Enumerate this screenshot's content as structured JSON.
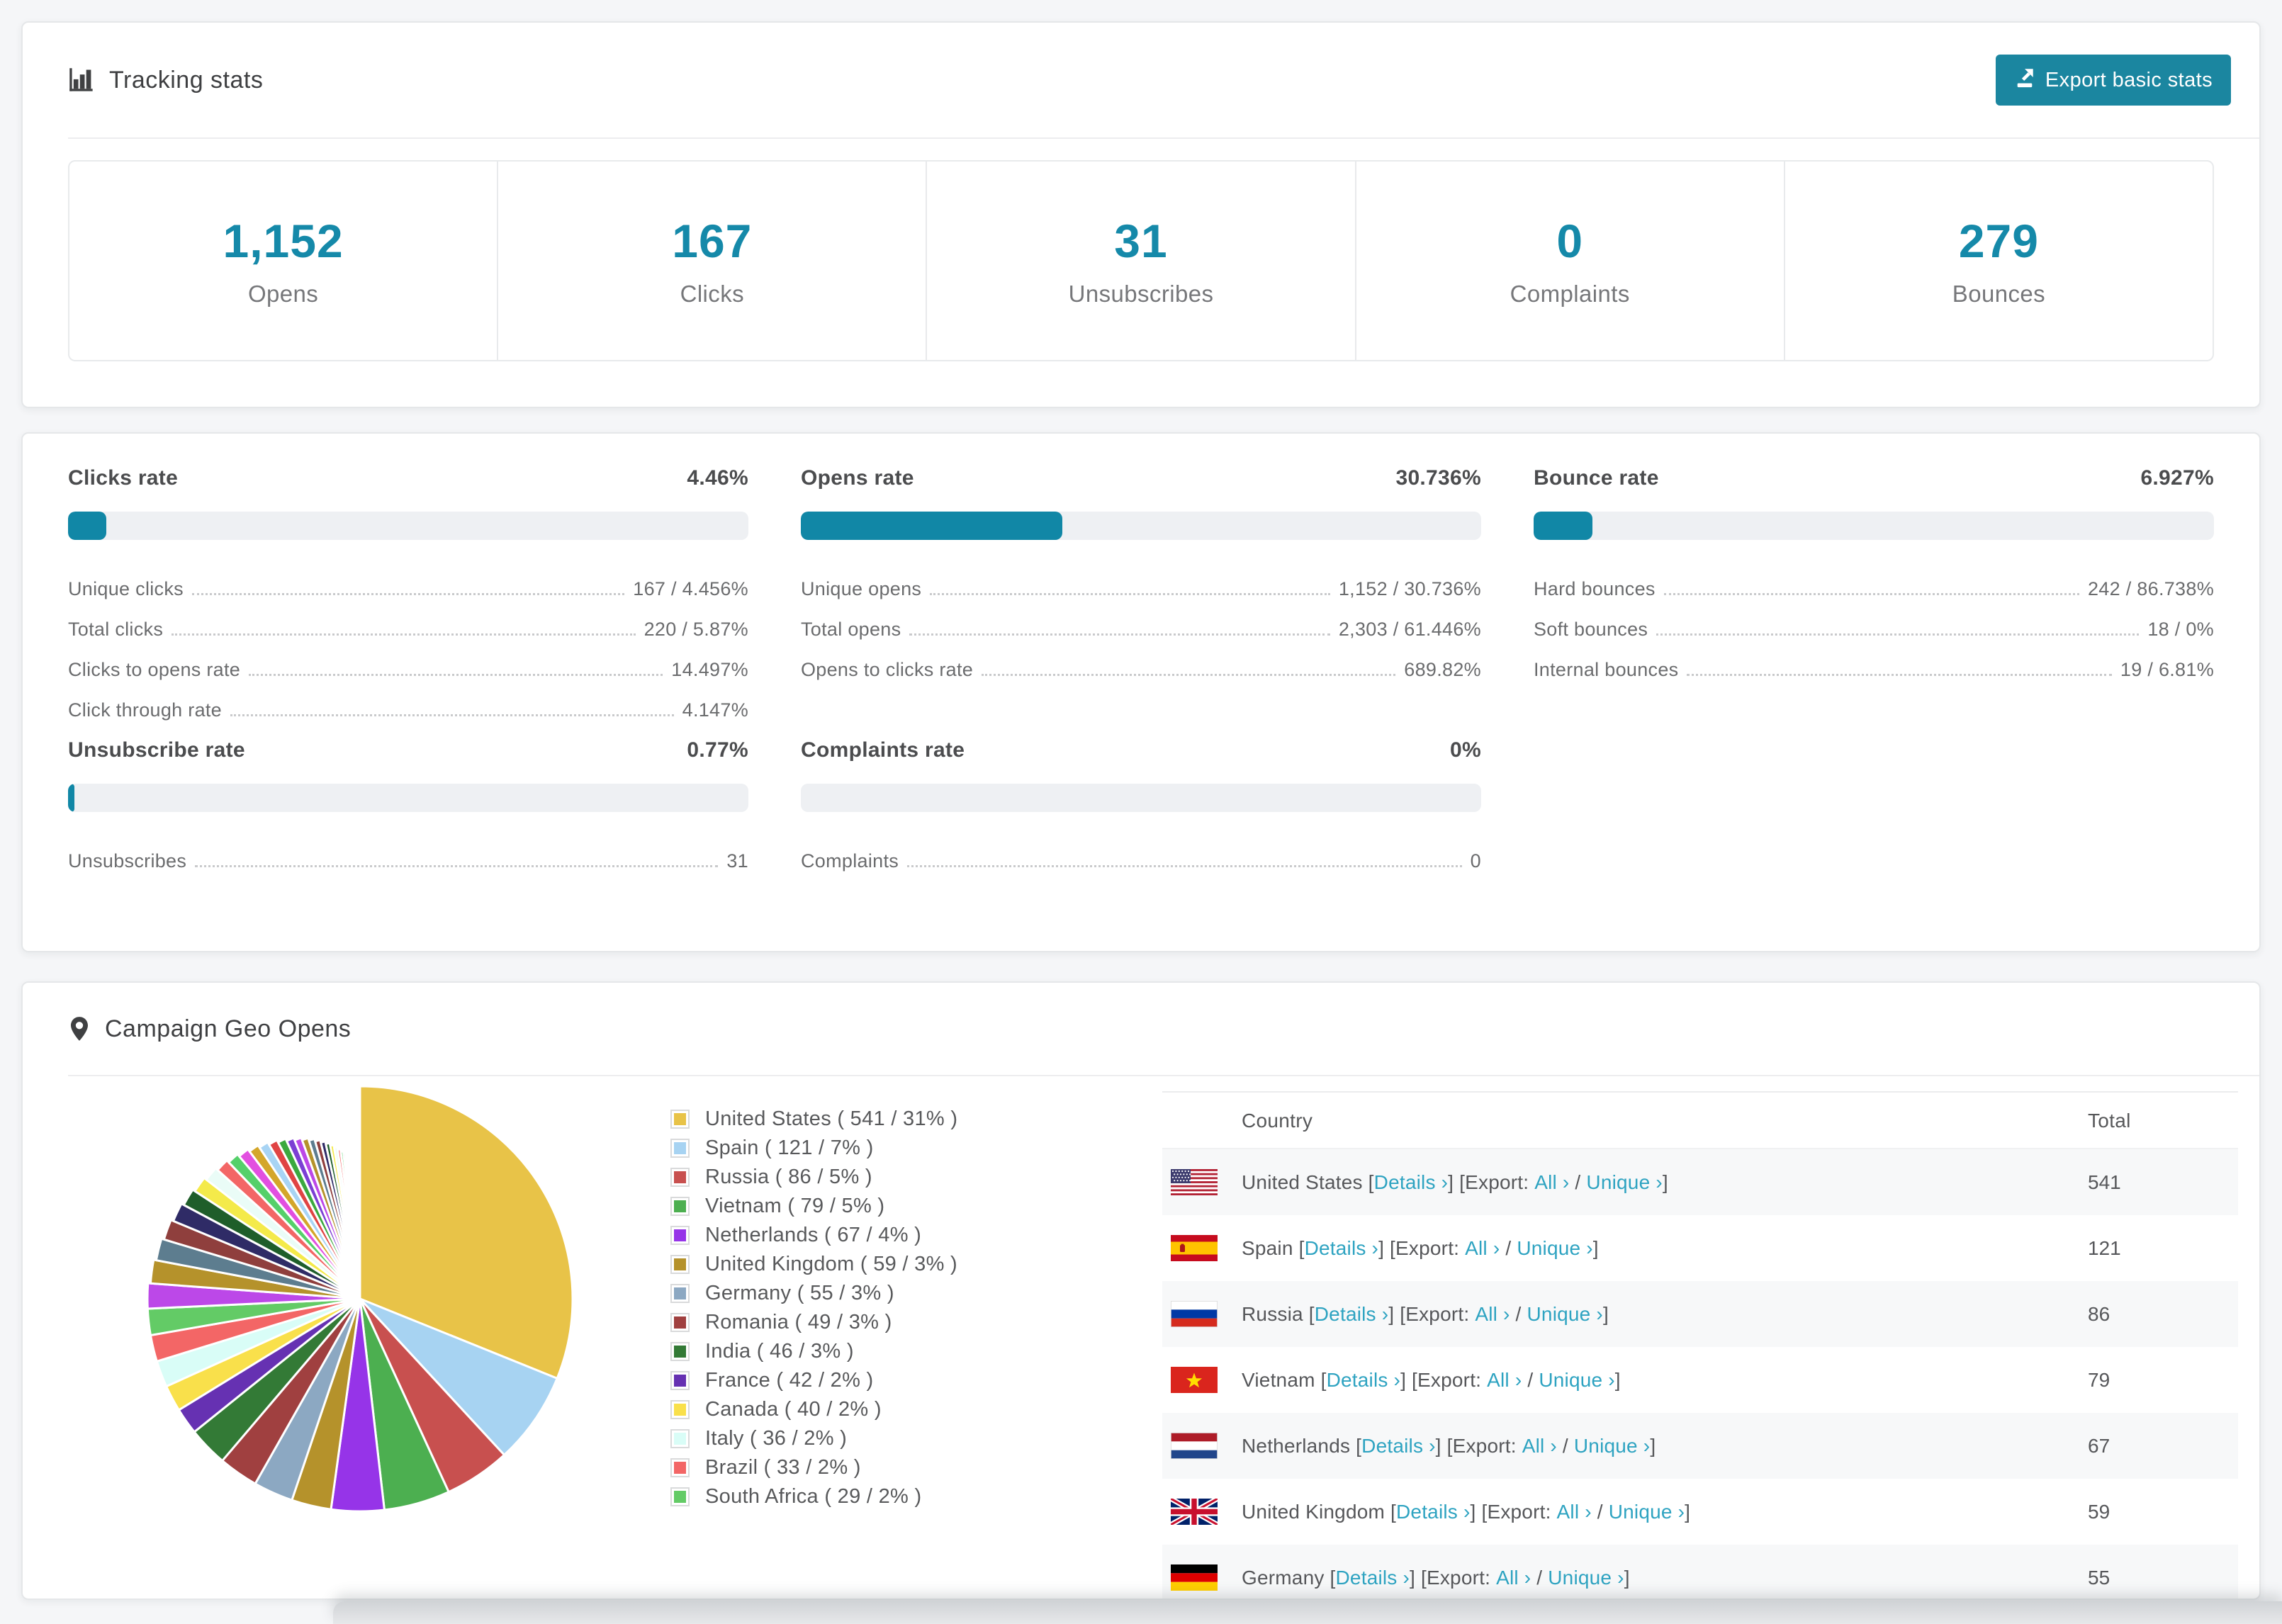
{
  "colors": {
    "accent_teal": "#1b86a0",
    "stat_teal": "#1589a9",
    "bar_teal": "#1187a6",
    "link_teal": "#2ea3c1",
    "bar_track": "#eef0f3",
    "stripe": "#f7f8f9"
  },
  "tracking": {
    "title": "Tracking stats",
    "export_button": "Export basic stats",
    "stats": [
      {
        "value": "1,152",
        "label": "Opens"
      },
      {
        "value": "167",
        "label": "Clicks"
      },
      {
        "value": "31",
        "label": "Unsubscribes"
      },
      {
        "value": "0",
        "label": "Complaints"
      },
      {
        "value": "279",
        "label": "Bounces"
      }
    ]
  },
  "rates": {
    "blocks": [
      {
        "title": "Clicks rate",
        "value": "4.46%",
        "bar_pct": 4.46,
        "rows": [
          {
            "label": "Unique clicks",
            "value": "167 / 4.456%"
          },
          {
            "label": "Total clicks",
            "value": "220 / 5.87%"
          },
          {
            "label": "Clicks to opens rate",
            "value": "14.497%"
          },
          {
            "label": "Click through rate",
            "value": "4.147%"
          }
        ]
      },
      {
        "title": "Opens rate",
        "value": "30.736%",
        "bar_pct": 30.736,
        "rows": [
          {
            "label": "Unique opens",
            "value": "1,152 / 30.736%"
          },
          {
            "label": "Total opens",
            "value": "2,303 / 61.446%"
          },
          {
            "label": "Opens to clicks rate",
            "value": "689.82%"
          }
        ]
      },
      {
        "title": "Bounce rate",
        "value": "6.927%",
        "bar_pct": 6.927,
        "rows": [
          {
            "label": "Hard bounces",
            "value": "242 / 86.738%"
          },
          {
            "label": "Soft bounces",
            "value": "18 / 0%"
          },
          {
            "label": "Internal bounces",
            "value": "19 / 6.81%"
          }
        ]
      },
      {
        "title": "Unsubscribe rate",
        "value": "0.77%",
        "bar_pct": 0.77,
        "rows": [
          {
            "label": "Unsubscribes",
            "value": "31"
          }
        ]
      },
      {
        "title": "Complaints rate",
        "value": "0%",
        "bar_pct": 0,
        "rows": [
          {
            "label": "Complaints",
            "value": "0"
          }
        ]
      }
    ]
  },
  "geo": {
    "title": "Campaign Geo Opens",
    "chart_data": {
      "type": "pie",
      "title": "Campaign Geo Opens",
      "legend_position": "right",
      "slices": [
        {
          "name": "United States",
          "value": 541,
          "pct": 31,
          "color": "#e8c348",
          "flag": "us"
        },
        {
          "name": "Spain",
          "value": 121,
          "pct": 7,
          "color": "#a7d3f2",
          "flag": "es"
        },
        {
          "name": "Russia",
          "value": 86,
          "pct": 5,
          "color": "#c8504f",
          "flag": "ru"
        },
        {
          "name": "Vietnam",
          "value": 79,
          "pct": 5,
          "color": "#4caf50",
          "flag": "vn"
        },
        {
          "name": "Netherlands",
          "value": 67,
          "pct": 4,
          "color": "#9634e8",
          "flag": "nl"
        },
        {
          "name": "United Kingdom",
          "value": 59,
          "pct": 3,
          "color": "#b5922b",
          "flag": "gb"
        },
        {
          "name": "Germany",
          "value": 55,
          "pct": 3,
          "color": "#8ca8c2",
          "flag": "de"
        },
        {
          "name": "Romania",
          "value": 49,
          "pct": 3,
          "color": "#a04040",
          "flag": "ro"
        },
        {
          "name": "India",
          "value": 46,
          "pct": 3,
          "color": "#337a36",
          "flag": "in"
        },
        {
          "name": "France",
          "value": 42,
          "pct": 2,
          "color": "#6631b2",
          "flag": "fr"
        },
        {
          "name": "Canada",
          "value": 40,
          "pct": 2,
          "color": "#f9e04b",
          "flag": "ca"
        },
        {
          "name": "Italy",
          "value": 36,
          "pct": 2,
          "color": "#d9fdf7",
          "flag": "it"
        },
        {
          "name": "Brazil",
          "value": 33,
          "pct": 2,
          "color": "#f36666",
          "flag": "br"
        },
        {
          "name": "South Africa",
          "value": 29,
          "pct": 2,
          "color": "#63cb66",
          "flag": "za"
        }
      ],
      "others_pcts": [
        1.9,
        1.8,
        1.7,
        1.6,
        1.5,
        1.4,
        1.3,
        1.2,
        1.1,
        1.0,
        0.95,
        0.9,
        0.85,
        0.8,
        0.75,
        0.7,
        0.65,
        0.6,
        0.55,
        0.5,
        0.45,
        0.4,
        0.36,
        0.33,
        0.3,
        0.27,
        0.24,
        0.21,
        0.19,
        0.17,
        0.15,
        0.13,
        0.11,
        0.1,
        0.09,
        0.08,
        0.07,
        0.06,
        0.05,
        0.04,
        0.03,
        0.03,
        0.02,
        0.02
      ],
      "others_palette": [
        "#bc48e8",
        "#b5922b",
        "#5d7d8f",
        "#8f3f3d",
        "#2f2b66",
        "#1f5e2a",
        "#f4ea4a",
        "#eafcf7",
        "#f36666",
        "#55d06a",
        "#e24fe0",
        "#d4a62a",
        "#a8d4f4",
        "#e04444",
        "#3ba93f",
        "#7c3fd4"
      ]
    },
    "legend_format": {
      "open": " ( ",
      "sep": " / ",
      "close": "% )"
    },
    "table": {
      "headers": {
        "country": "Country",
        "total": "Total"
      },
      "tokens": {
        "lb": " [",
        "rb": "]",
        "details": "Details ›",
        "export": "Export: ",
        "all": "All ›",
        "slash": " / ",
        "unique": "Unique ›"
      },
      "rows": [
        {
          "country": "United States",
          "total": "541",
          "flag": "us"
        },
        {
          "country": "Spain",
          "total": "121",
          "flag": "es"
        },
        {
          "country": "Russia",
          "total": "86",
          "flag": "ru"
        },
        {
          "country": "Vietnam",
          "total": "79",
          "flag": "vn"
        },
        {
          "country": "Netherlands",
          "total": "67",
          "flag": "nl"
        },
        {
          "country": "United Kingdom",
          "total": "59",
          "flag": "gb"
        },
        {
          "country": "Germany",
          "total": "55",
          "flag": "de"
        }
      ]
    }
  }
}
